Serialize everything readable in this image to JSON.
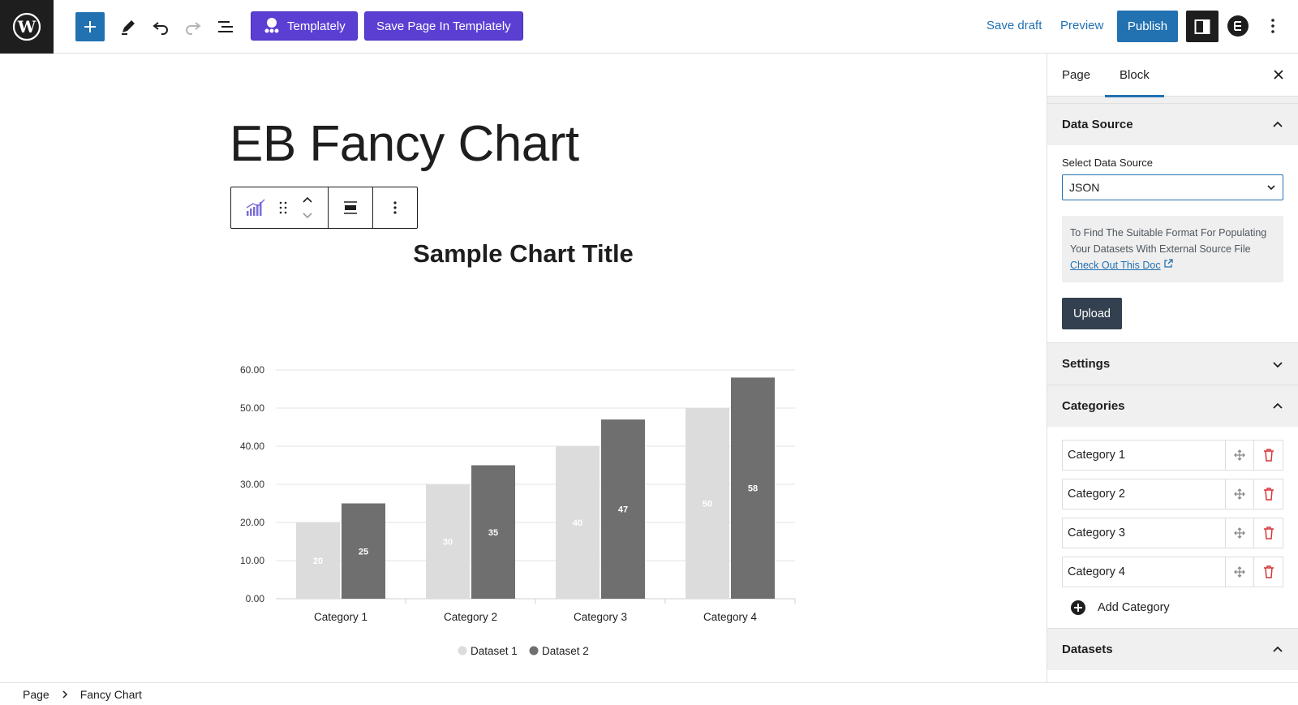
{
  "topbar": {
    "wp_logo_icon": "wordpress-icon",
    "add_icon": "plus-icon",
    "tools_icon": "pencil-icon",
    "undo_icon": "undo-icon",
    "redo_icon": "redo-icon",
    "list_view_icon": "list-view-icon",
    "templately_label": "Templately",
    "save_templately_label": "Save Page In Templately",
    "save_draft_label": "Save draft",
    "preview_label": "Preview",
    "publish_label": "Publish",
    "settings_icon": "sidebar-toggle-icon",
    "eb_icon": "essential-blocks-icon",
    "options_icon": "more-vertical-icon"
  },
  "editor": {
    "page_title": "EB Fancy Chart",
    "block_toolbar": {
      "block_icon": "chart-block-icon",
      "drag_icon": "drag-handle-icon",
      "move_icon": "move-up-down-icon",
      "align_icon": "align-icon",
      "more_icon": "more-vertical-icon"
    }
  },
  "chart_data": {
    "type": "bar",
    "title": "Sample Chart Title",
    "categories": [
      "Category 1",
      "Category 2",
      "Category 3",
      "Category 4"
    ],
    "series": [
      {
        "name": "Dataset 1",
        "values": [
          20,
          30,
          40,
          50
        ],
        "color": "#dcdcdc"
      },
      {
        "name": "Dataset 2",
        "values": [
          25,
          35,
          47,
          58
        ],
        "color": "#6f6f6f"
      }
    ],
    "y_ticks": [
      "0.00",
      "10.00",
      "20.00",
      "30.00",
      "40.00",
      "50.00",
      "60.00"
    ],
    "ylim": [
      0,
      60
    ],
    "grid": true,
    "legend_position": "bottom"
  },
  "sidebar": {
    "tab_page": "Page",
    "tab_block": "Block",
    "close_icon": "close-icon",
    "data_source": {
      "heading": "Data Source",
      "select_label": "Select Data Source",
      "select_value": "JSON",
      "info_text": "To Find The Suitable Format For Populating Your Datasets With External Source File ",
      "info_link": "Check Out This Doc",
      "upload_label": "Upload"
    },
    "settings_heading": "Settings",
    "categories": {
      "heading": "Categories",
      "items": [
        "Category 1",
        "Category 2",
        "Category 3",
        "Category 4"
      ],
      "add_label": "Add Category"
    },
    "datasets_heading": "Datasets"
  },
  "footer": {
    "crumb_1": "Page",
    "crumb_2": "Fancy Chart"
  },
  "colors": {
    "accent": "#2271b1",
    "templately": "#5b3fd3",
    "danger": "#d63638"
  }
}
